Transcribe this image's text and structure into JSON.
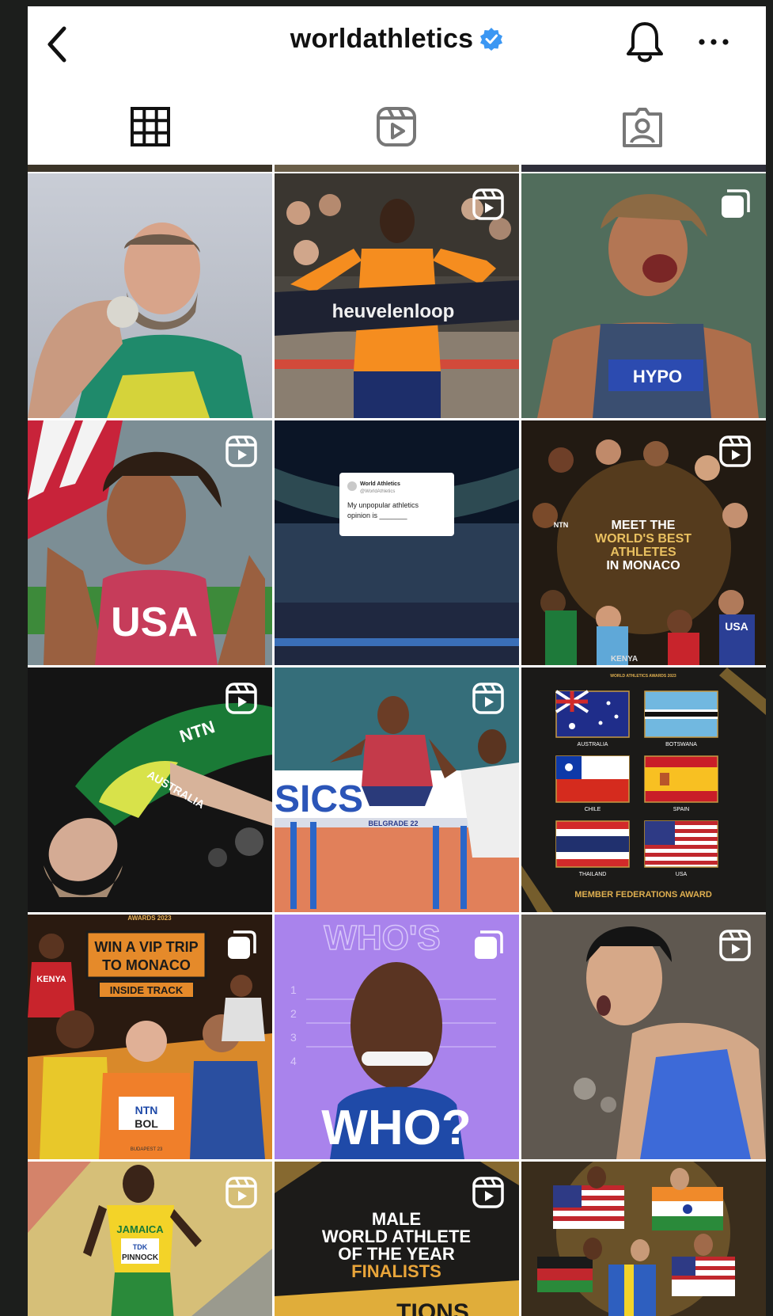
{
  "header": {
    "username": "worldathletics",
    "verified_icon": "verified-badge-icon",
    "back_icon": "chevron-left-icon",
    "bell_icon": "bell-icon",
    "more_icon": "more-horizontal-icon"
  },
  "tabs": [
    {
      "name": "posts-grid",
      "icon": "grid-icon",
      "active": true
    },
    {
      "name": "reels",
      "icon": "reels-icon",
      "active": false
    },
    {
      "name": "tagged",
      "icon": "tagged-user-icon",
      "active": false
    }
  ],
  "posts": [
    {
      "badge": "reel-icon",
      "text": []
    },
    {
      "badge": "reel-icon",
      "text": [
        "heuvelenloop"
      ]
    },
    {
      "badge": "carousel-icon",
      "text": [
        "HYPO"
      ]
    },
    {
      "badge": "reel-icon",
      "text": [
        "USA"
      ]
    },
    {
      "badge": "none",
      "text": [
        "World Athletics",
        "@WorldAthletics",
        "My unpopular athletics opinion is ______"
      ]
    },
    {
      "badge": "reel-icon",
      "text": [
        "MEET THE",
        "WORLD'S BEST",
        "ATHLETES",
        "IN MONACO",
        "NTN",
        "USA",
        "KENYA"
      ]
    },
    {
      "badge": "reel-icon",
      "text": [
        "NTN",
        "AUSTRALIA"
      ]
    },
    {
      "badge": "reel-icon",
      "text": [
        "SICS",
        "BELGRADE 22"
      ]
    },
    {
      "badge": "none",
      "text": [
        "WORLD ATHLETICS AWARDS 2023",
        "AUSTRALIA",
        "BOTSWANA",
        "CHILE",
        "SPAIN",
        "THAILAND",
        "USA",
        "MEMBER FEDERATIONS AWARD"
      ]
    },
    {
      "badge": "carousel-icon",
      "text": [
        "AWARDS 2023",
        "WIN A VIP TRIP",
        "TO MONACO",
        "INSIDE TRACK",
        "KENYA",
        "NTN",
        "BOL",
        "BUDAPEST 23"
      ]
    },
    {
      "badge": "carousel-icon",
      "text": [
        "WHO'S",
        "1",
        "2",
        "3",
        "4",
        "WHO?"
      ]
    },
    {
      "badge": "reel-icon",
      "text": []
    },
    {
      "badge": "reel-icon",
      "text": [
        "JAMAICA",
        "TDK",
        "PINNOCK"
      ]
    },
    {
      "badge": "reel-icon",
      "text": [
        "MALE",
        "WORLD ATHLETE",
        "OF THE YEAR",
        "FINALISTS",
        "TIONS"
      ]
    },
    {
      "badge": "none",
      "text": []
    }
  ]
}
